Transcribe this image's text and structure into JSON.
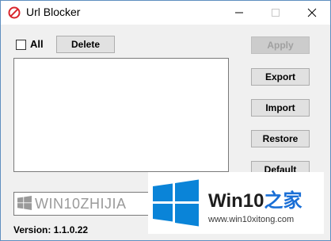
{
  "window": {
    "title": "Url Blocker"
  },
  "all_checkbox": {
    "label": "All",
    "checked": false
  },
  "buttons": {
    "delete": "Delete",
    "apply": "Apply",
    "export": "Export",
    "import": "Import",
    "restore": "Restore",
    "default": "Default"
  },
  "url_input": {
    "value": "WIN10ZHIJIA"
  },
  "version_label": "Version: 1.1.0.22",
  "watermark": {
    "brand": "Win10",
    "brand_accent": "之家",
    "url": "www.win10xitong.com"
  },
  "colors": {
    "accent": "#0a84d8",
    "brand_accent": "#1a6fd6"
  },
  "icons": {
    "app": "block-icon",
    "windows": "windows-logo-icon"
  }
}
